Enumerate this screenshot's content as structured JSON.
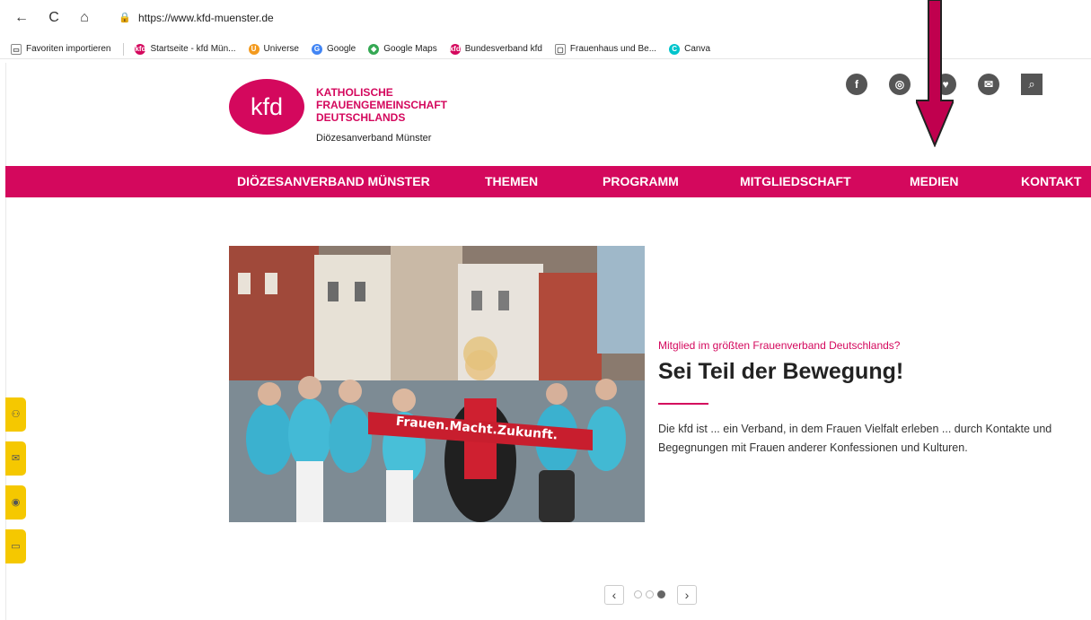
{
  "browser": {
    "url": "https://www.kfd-muenster.de",
    "back_icon": "←",
    "reload_icon": "C",
    "home_icon": "⌂",
    "lock_icon": "🔒",
    "bookmarks": [
      {
        "label": "Favoriten importieren",
        "color": "#ffffff",
        "glyph": "▭"
      },
      {
        "label": "Startseite - kfd Mün...",
        "color": "#d4085d",
        "glyph": "kfd"
      },
      {
        "label": "Universe",
        "color": "#f39a1e",
        "glyph": "U"
      },
      {
        "label": "Google",
        "color": "#4285f4",
        "glyph": "G"
      },
      {
        "label": "Google Maps",
        "color": "#34a853",
        "glyph": "◆"
      },
      {
        "label": "Bundesverband kfd",
        "color": "#d4085d",
        "glyph": "kfd"
      },
      {
        "label": "Frauenhaus und Be...",
        "color": "#ffffff",
        "glyph": "▢"
      },
      {
        "label": "Canva",
        "color": "#00c4cc",
        "glyph": "C"
      }
    ]
  },
  "header": {
    "logo_text": "kfd",
    "org_line1": "KATHOLISCHE",
    "org_line2": "FRAUENGEMEINSCHAFT",
    "org_line3": "DEUTSCHLANDS",
    "subtitle": "Diözesanverband Münster",
    "social": [
      {
        "name": "facebook-icon",
        "glyph": "f"
      },
      {
        "name": "instagram-icon",
        "glyph": "◎"
      },
      {
        "name": "location-icon",
        "glyph": "♥"
      },
      {
        "name": "newsletter-icon",
        "glyph": "✉"
      }
    ],
    "search_glyph": "⌕"
  },
  "nav": {
    "items": [
      {
        "label": "DIÖZESANVERBAND MÜNSTER"
      },
      {
        "label": "THEMEN"
      },
      {
        "label": "PROGRAMM"
      },
      {
        "label": "MITGLIEDSCHAFT"
      },
      {
        "label": "MEDIEN"
      },
      {
        "label": "KONTAKT"
      }
    ]
  },
  "hero": {
    "banner_text": "Frauen.Macht.Zukunft.",
    "teaser": "Mitglied im größten Frauenverband Deutschlands?",
    "title": "Sei Teil der Bewegung!",
    "description": "Die kfd ist ... ein Verband, in dem Frauen Vielfalt erleben ... durch Kontakte und Begegnungen mit Frauen anderer Konfessionen und Kulturen."
  },
  "slider": {
    "prev": "‹",
    "next": "›",
    "slide_count": 3,
    "active_slide": 3
  },
  "sidebar": {
    "buttons": [
      {
        "name": "users-icon",
        "glyph": "⚇"
      },
      {
        "name": "newsletter-icon",
        "glyph": "✉"
      },
      {
        "name": "location-icon",
        "glyph": "◉"
      },
      {
        "name": "book-icon",
        "glyph": "▭"
      }
    ]
  },
  "colors": {
    "brand": "#d4085d",
    "sidebar": "#f5c800",
    "arrow": "#c0004e"
  }
}
